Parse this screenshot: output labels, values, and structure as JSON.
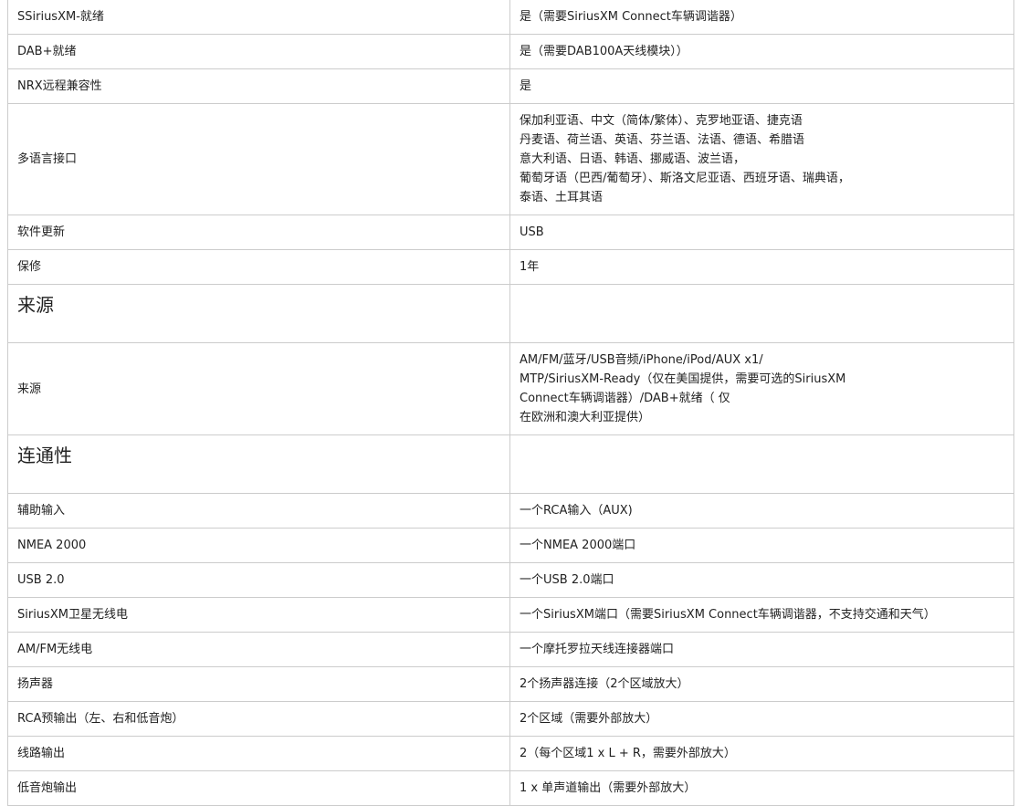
{
  "specs": [
    {
      "label": "SSiriusXM-就绪",
      "value": "是（需要SiriusXM Connect车辆调谐器）"
    },
    {
      "label": "DAB+就绪",
      "value": "是（需要DAB100A天线模块））"
    },
    {
      "label": "NRX远程兼容性",
      "value": "是"
    },
    {
      "label": "多语言接口",
      "value": "保加利亚语、中文（简体/繁体）、克罗地亚语、捷克语\n丹麦语、荷兰语、英语、芬兰语、法语、德语、希腊语\n意大利语、日语、韩语、挪威语、波兰语，\n葡萄牙语（巴西/葡萄牙）、斯洛文尼亚语、西班牙语、瑞典语，\n泰语、土耳其语"
    },
    {
      "label": "软件更新",
      "value": "USB"
    },
    {
      "label": "保修",
      "value": "1年"
    },
    {
      "heading": "来源"
    },
    {
      "label": "来源",
      "value": "AM/FM/蓝牙/USB音频/iPhone/iPod/AUX x1/\nMTP/SiriusXM-Ready（仅在美国提供，需要可选的SiriusXM\nConnect车辆调谐器）/DAB+就绪（ 仅\n在欧洲和澳大利亚提供）"
    },
    {
      "heading": "连通性"
    },
    {
      "label": "辅助输入",
      "value": "一个RCA输入（AUX)"
    },
    {
      "label": "NMEA 2000",
      "value": "一个NMEA 2000端口"
    },
    {
      "label": "USB 2.0",
      "value": "一个USB 2.0端口"
    },
    {
      "label": "SiriusXM卫星无线电",
      "value": "一个SiriusXM端口（需要SiriusXM Connect车辆调谐器，不支持交通和天气）"
    },
    {
      "label": "AM/FM无线电",
      "value": "一个摩托罗拉天线连接器端口"
    },
    {
      "label": "扬声器",
      "value": "2个扬声器连接（2个区域放大）"
    },
    {
      "label": "RCA预输出（左、右和低音炮）",
      "value": "2个区域（需要外部放大）"
    },
    {
      "label": "线路输出",
      "value": "2（每个区域1 x L + R，需要外部放大）"
    },
    {
      "label": "低音炮输出",
      "value": "1 x 单声道输出（需要外部放大）"
    }
  ]
}
